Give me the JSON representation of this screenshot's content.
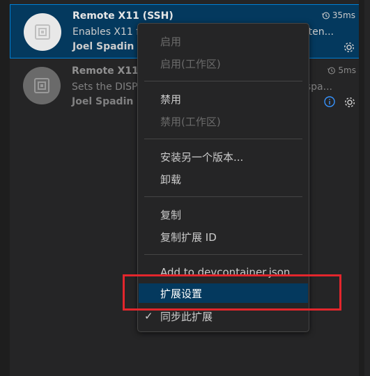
{
  "extensions": [
    {
      "title": "Remote X11 (SSH)",
      "description": "Enables X11 f",
      "description_tail": "exten...",
      "author": "Joel Spadin",
      "time": "35ms"
    },
    {
      "title": "Remote X11",
      "description": "Sets the DISP",
      "description_tail": "rkspa...",
      "author": "Joel Spadin",
      "time": "5ms"
    }
  ],
  "menu": {
    "enable": "启用",
    "enable_workspace": "启用(工作区)",
    "disable": "禁用",
    "disable_workspace": "禁用(工作区)",
    "install_other_version": "安装另一个版本...",
    "uninstall": "卸载",
    "copy": "复制",
    "copy_extension_id": "复制扩展 ID",
    "add_to_devcontainer": "Add to devcontainer.json",
    "extension_settings": "扩展设置",
    "sync_extension": "同步此扩展",
    "check_mark": "✓"
  },
  "icons": {
    "extension_logo": "x11-logo-icon",
    "time": "history-icon",
    "settings": "gear-icon",
    "info": "info-icon"
  },
  "colors": {
    "accent": "#007fd4",
    "selection": "#04395e",
    "annotation": "#e3262c"
  }
}
